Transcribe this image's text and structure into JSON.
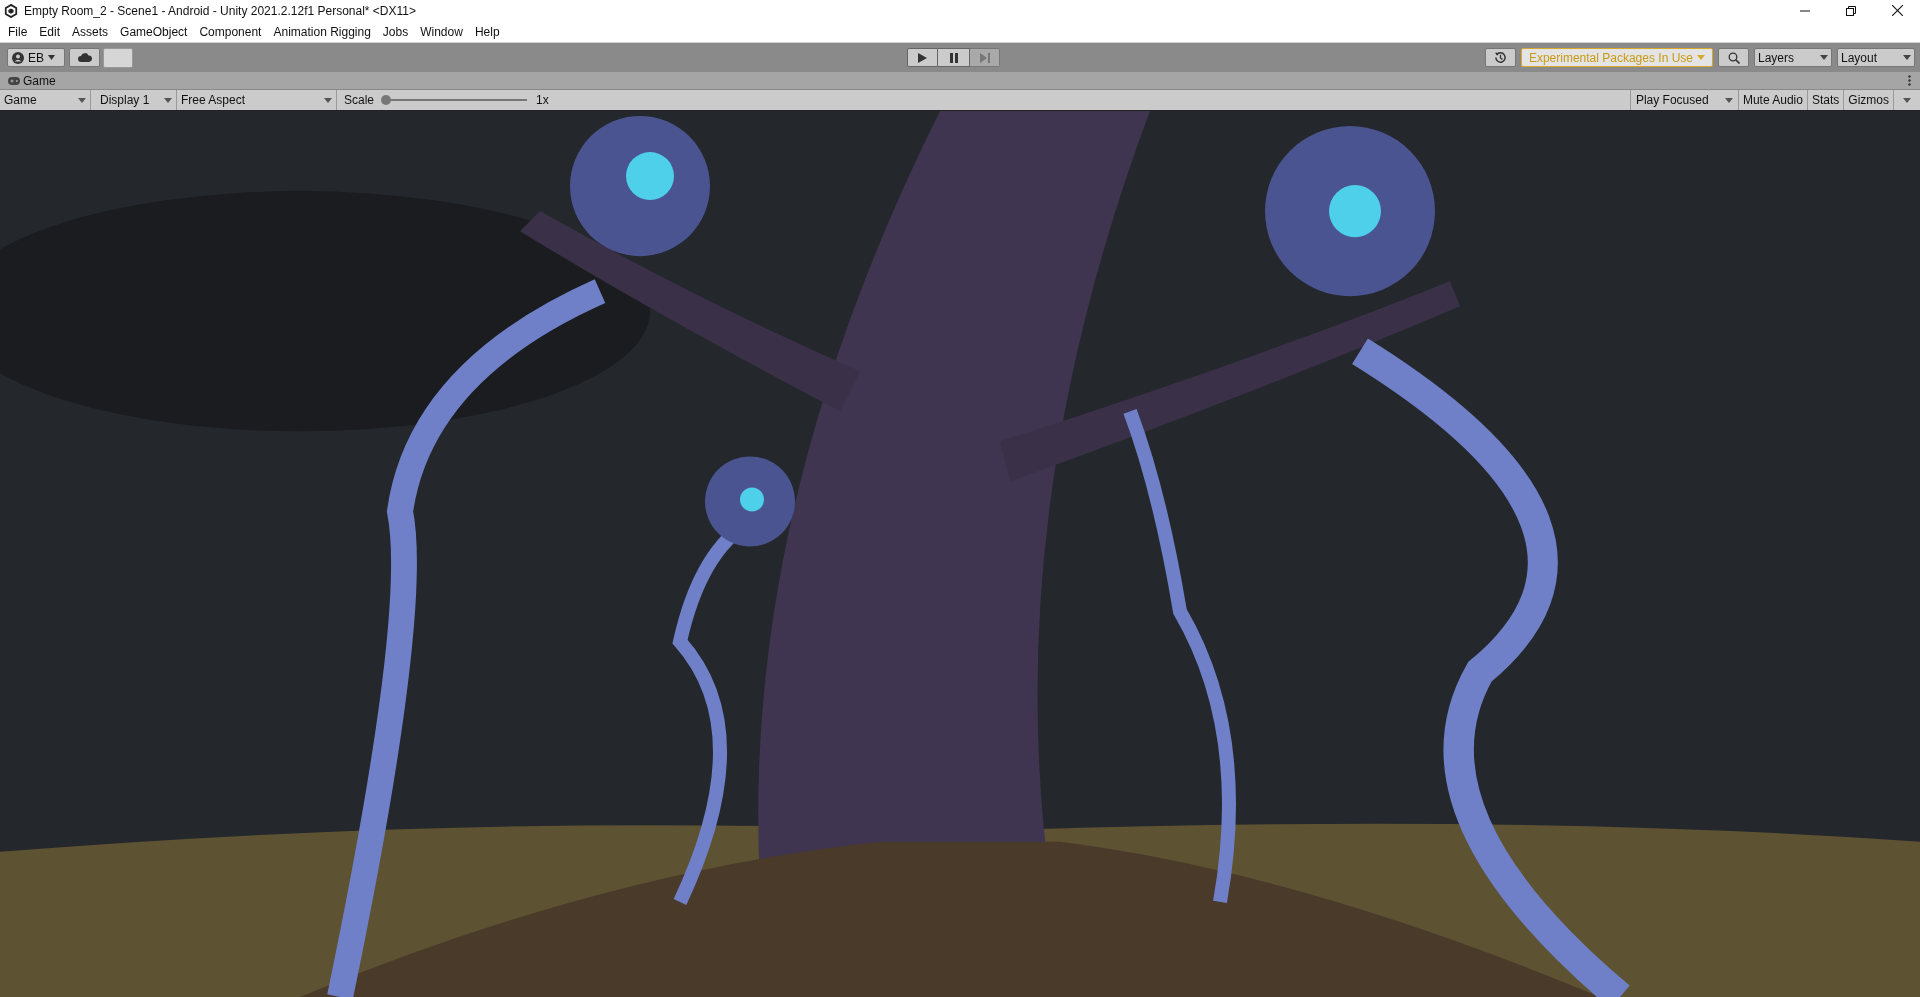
{
  "window": {
    "title": "Empty Room_2 - Scene1 - Android - Unity 2021.2.12f1 Personal* <DX11>"
  },
  "menu": [
    "File",
    "Edit",
    "Assets",
    "GameObject",
    "Component",
    "Animation Rigging",
    "Jobs",
    "Window",
    "Help"
  ],
  "toolbar": {
    "account": "EB",
    "experimental": "Experimental Packages In Use",
    "layers": "Layers",
    "layout": "Layout"
  },
  "tab": {
    "label": "Game"
  },
  "game_toolbar": {
    "view": "Game",
    "display": "Display 1",
    "aspect": "Free Aspect",
    "scale": {
      "label": "Scale",
      "level": 0,
      "reading": "1x"
    },
    "play_focus": "Play Focused",
    "toggles": [
      {
        "label": "Mute Audio",
        "on": false
      },
      {
        "label": "Stats",
        "on": false
      },
      {
        "label": "Gizmos",
        "on": false
      }
    ]
  }
}
